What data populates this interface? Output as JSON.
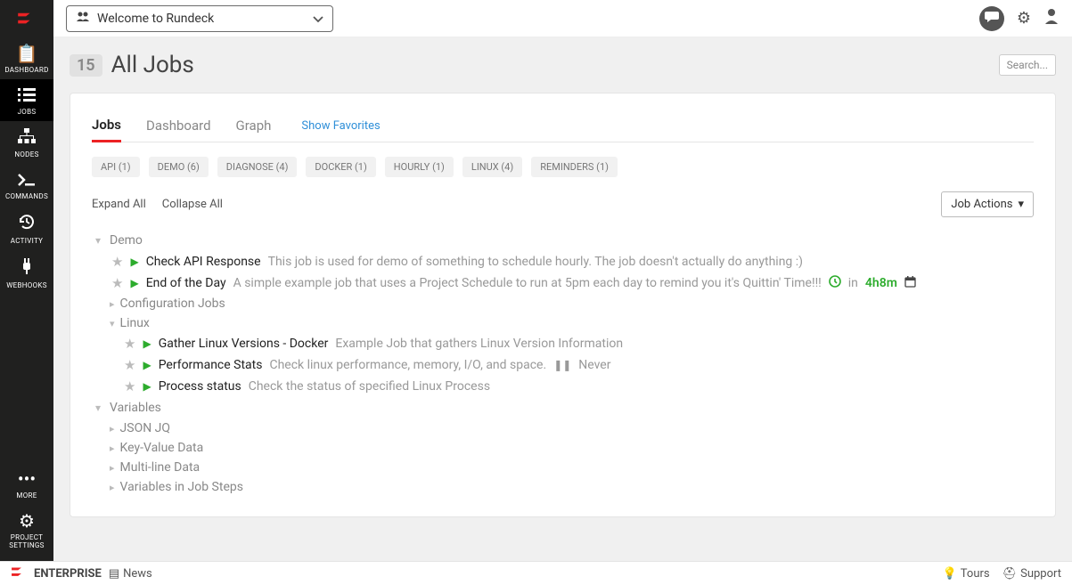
{
  "project_picker": {
    "title": "Welcome to Rundeck"
  },
  "sidebar": {
    "items": [
      {
        "label": "DASHBOARD",
        "icon": "dashboard"
      },
      {
        "label": "JOBS",
        "icon": "jobs",
        "active": true
      },
      {
        "label": "NODES",
        "icon": "nodes"
      },
      {
        "label": "COMMANDS",
        "icon": "commands"
      },
      {
        "label": "ACTIVITY",
        "icon": "activity"
      },
      {
        "label": "WEBHOOKS",
        "icon": "webhooks"
      }
    ],
    "more": {
      "label": "MORE"
    },
    "settings": {
      "label": "PROJECT SETTINGS"
    }
  },
  "page": {
    "count": "15",
    "title": "All Jobs",
    "search_label": "Search..."
  },
  "tabs": {
    "jobs": "Jobs",
    "dashboard": "Dashboard",
    "graph": "Graph",
    "favorites": "Show Favorites"
  },
  "tags": [
    "API (1)",
    "DEMO (6)",
    "DIAGNOSE (4)",
    "DOCKER (1)",
    "HOURLY (1)",
    "LINUX (4)",
    "REMINDERS (1)"
  ],
  "controls": {
    "expand": "Expand All",
    "collapse": "Collapse All",
    "job_actions": "Job Actions"
  },
  "tree": {
    "demo": {
      "label": "Demo",
      "jobs": [
        {
          "name": "Check API Response",
          "desc": "This job is used for demo of something to schedule hourly. The job doesn't actually do anything :)"
        },
        {
          "name": "End of the Day",
          "desc": "A simple example job that uses a Project Schedule to run at 5pm each day to remind you it's Quittin' Time!!!",
          "sched_prefix": "in",
          "sched_time": "4h8m"
        }
      ]
    },
    "config": {
      "label": "Configuration Jobs"
    },
    "linux": {
      "label": "Linux",
      "jobs": [
        {
          "name": "Gather Linux Versions - Docker",
          "desc": "Example Job that gathers Linux Version Information"
        },
        {
          "name": "Performance Stats",
          "desc": "Check linux performance, memory, I/O, and space.",
          "never": "Never"
        },
        {
          "name": "Process status",
          "desc": "Check the status of specified Linux Process"
        }
      ]
    },
    "variables": {
      "label": "Variables",
      "subs": [
        "JSON JQ",
        "Key-Value Data",
        "Multi-line Data",
        "Variables in Job Steps"
      ]
    }
  },
  "footer": {
    "brand": "ENTERPRISE",
    "news": "News",
    "tours": "Tours",
    "support": "Support"
  }
}
